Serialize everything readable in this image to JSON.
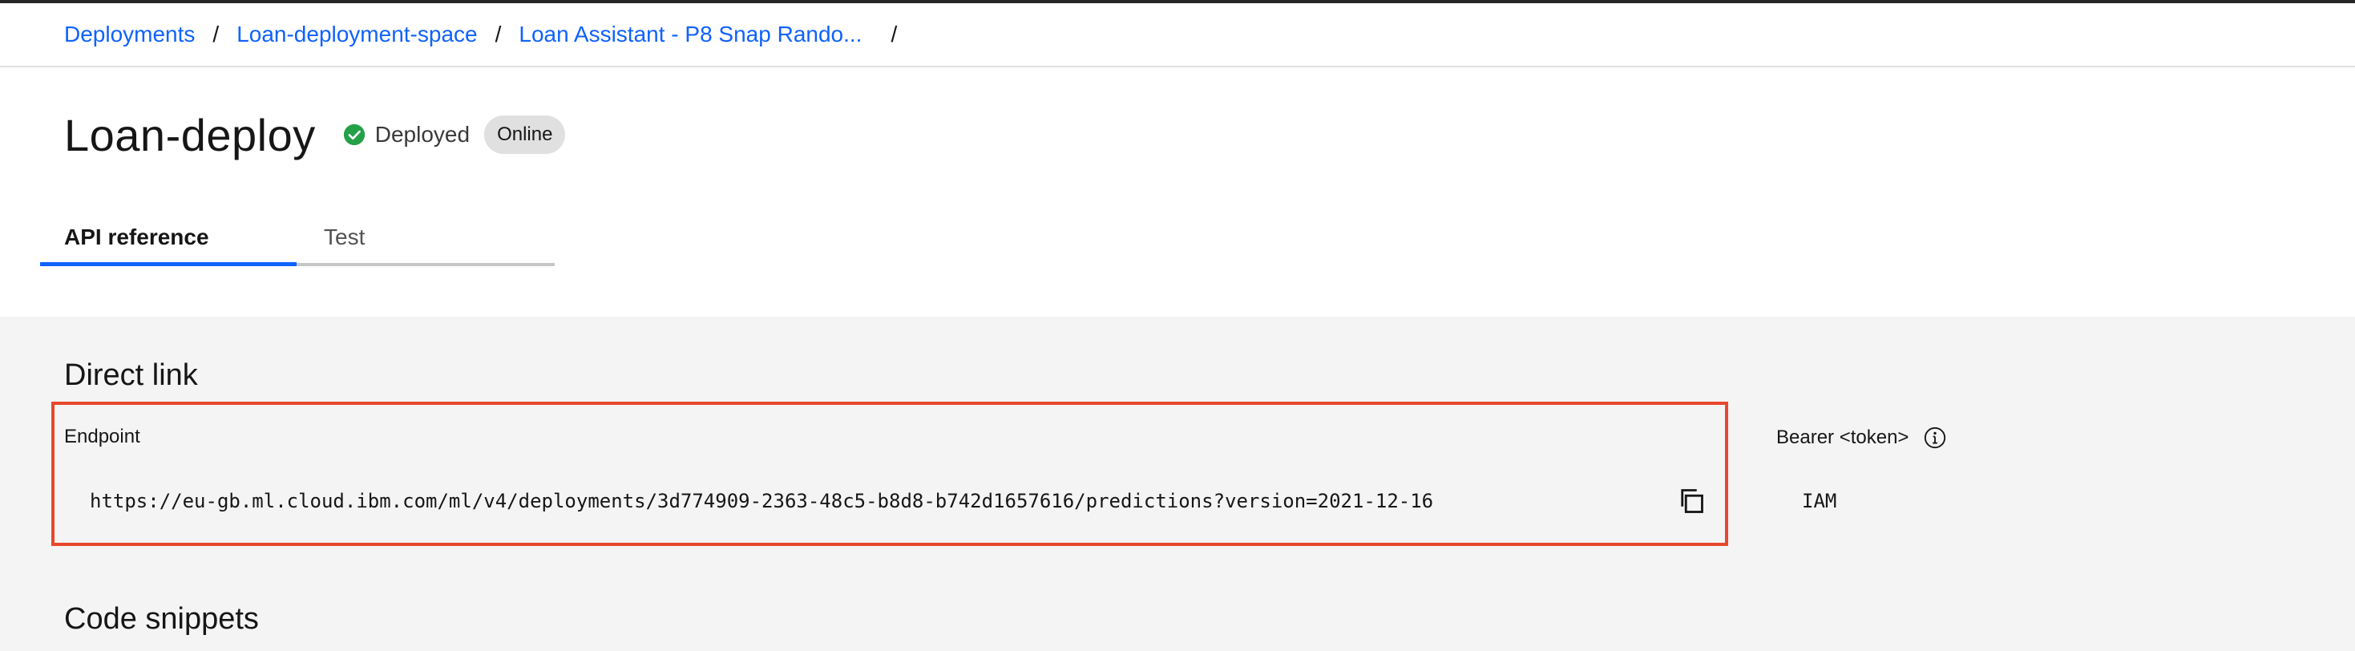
{
  "breadcrumb": {
    "items": [
      "Deployments",
      "Loan-deployment-space",
      "Loan Assistant - P8 Snap Rando..."
    ],
    "separator": "/"
  },
  "header": {
    "title": "Loan-deploy",
    "status": "Deployed",
    "badge": "Online"
  },
  "tabs": [
    {
      "label": "API reference",
      "active": true
    },
    {
      "label": "Test",
      "active": false
    }
  ],
  "direct_link": {
    "title": "Direct link",
    "endpoint_label": "Endpoint",
    "endpoint_url": "https://eu-gb.ml.cloud.ibm.com/ml/v4/deployments/3d774909-2363-48c5-b8d8-b742d1657616/predictions?version=2021-12-16",
    "auth_label": "Bearer <token>",
    "auth_value": "IAM"
  },
  "code_snippets": {
    "title": "Code snippets"
  },
  "colors": {
    "link": "#0f62fe",
    "status_success": "#24a148",
    "highlight_border": "#e8472b",
    "content_bg": "#f4f4f4"
  },
  "icons": {
    "status": "checkmark-filled-icon",
    "copy": "copy-icon",
    "info": "information-icon"
  }
}
